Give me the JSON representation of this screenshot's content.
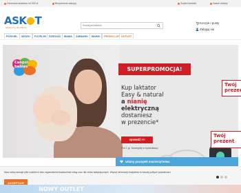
{
  "topbar": {
    "shipping": "Darmowa dostawa od 300 zł",
    "secure": "Bezpieczne zakupy",
    "contact": "Szybki kontakt",
    "stores": "Nasze sklepy"
  },
  "header": {
    "logo": {
      "pre": "ASK",
      "post": "T",
      "tagline": "bezpieczny dla dziecka"
    },
    "search_placeholder": "Szukaj produktów",
    "cart_label": "Koszyk / pusty",
    "login_label": "Zaloguj się"
  },
  "nav": {
    "items": [
      "POŚCIEL",
      "WÓZKI",
      "FOTELIKI",
      "DZIECKO",
      "MAMA",
      "ZABAWKI",
      "MARKI",
      "PROMOCJE",
      "OUTLET"
    ]
  },
  "hero": {
    "brand_badge": {
      "line1": "Canpol",
      "line2": "babies"
    },
    "superpromo": "SUPERPROMOCJA!",
    "headline": {
      "line1": "Kup laktator",
      "line2": "Easy & natural",
      "line3_pre": "a ",
      "line3_red": "nianię",
      "line4": "elektryczną",
      "line5": "dostaniesz",
      "line6": "w prezencie*"
    },
    "cta": "sprawdź >>",
    "footnote": "*Do 1 gr. Szczegóły w sprzedawcy",
    "gift_side": {
      "line1": "Twój",
      "line2": "prezent"
    },
    "gift_tag": {
      "line1": "Twój",
      "line2": "prezent"
    }
  },
  "strip": {
    "text": "Udany początek macierzyństwa"
  },
  "cookie": {
    "message": "Nasz sklep stosuje pliki cookies w celu zapewnienia świadczenia usług oraz dla celów statystycznych. Więcej informacji znajdziesz w naszej polityce prywatności.",
    "accept": "AKCEPTUJE"
  },
  "peek": {
    "text": "NOWY OUTLET"
  },
  "carousel": {
    "total": 3,
    "active": 0
  },
  "colors": {
    "brand_blue": "#1f6eb8",
    "accent_orange": "#e8722a",
    "promo_red": "#d11e25",
    "strip_blue": "#4aa5db"
  }
}
